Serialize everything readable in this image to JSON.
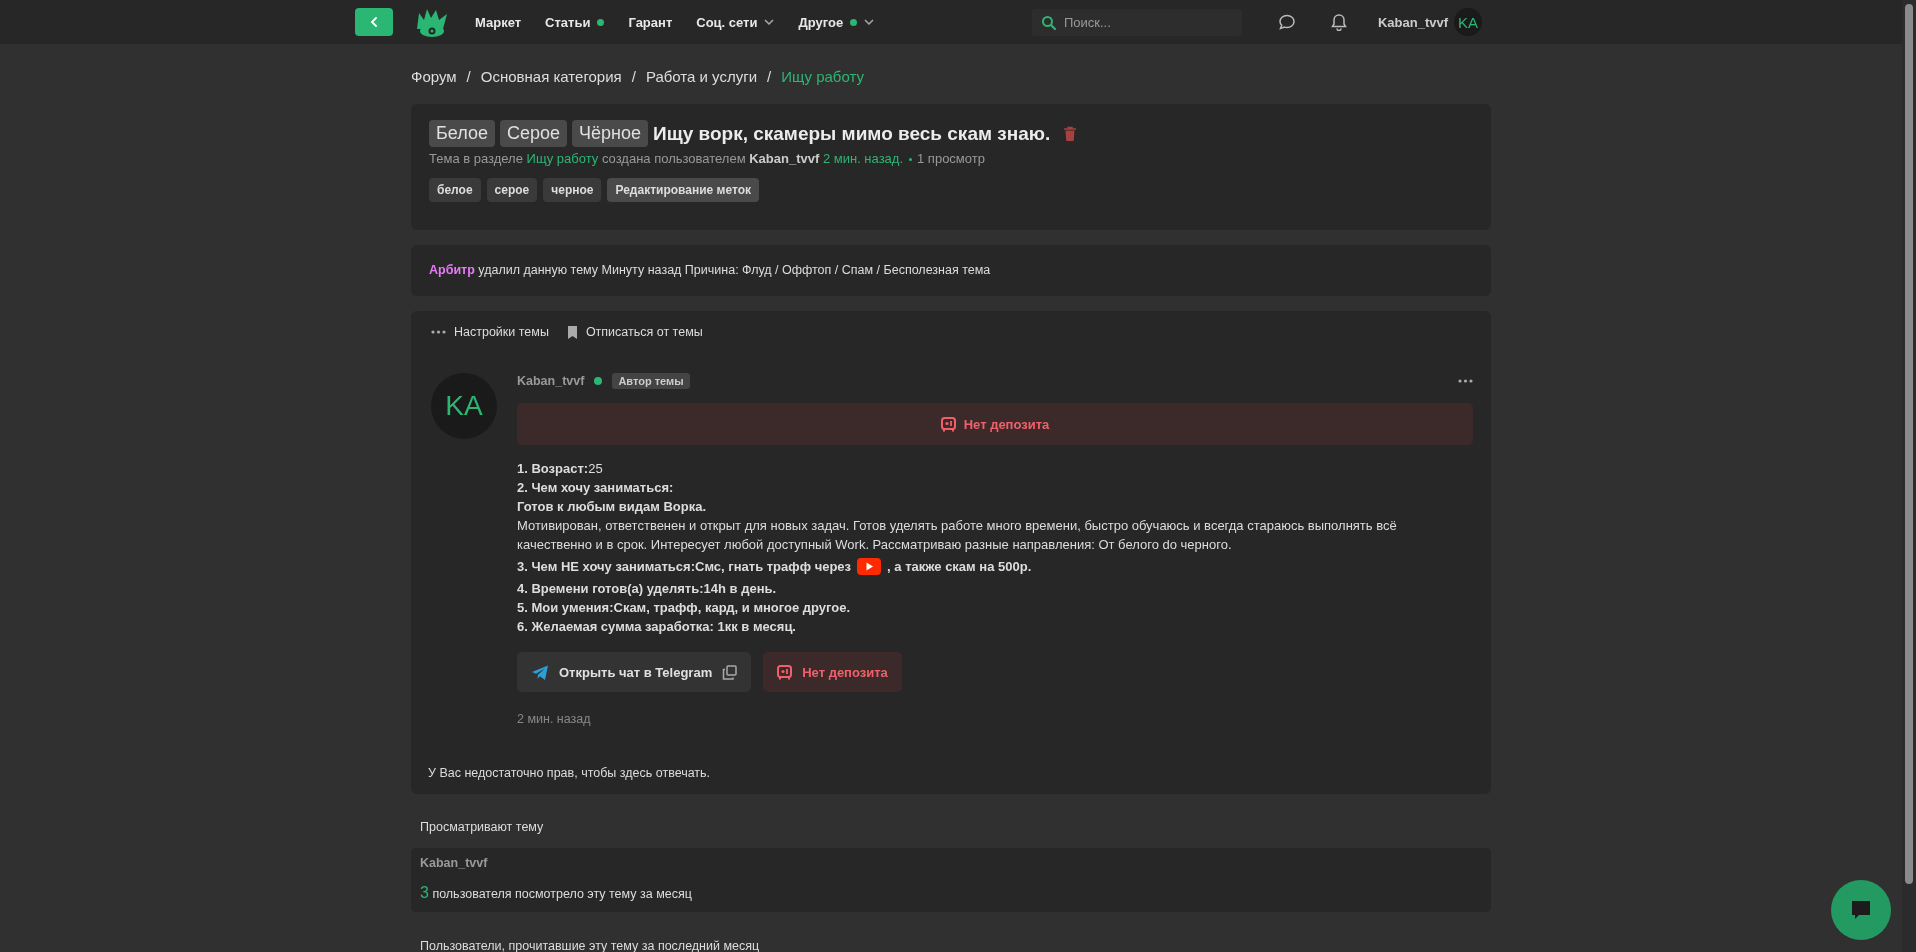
{
  "header": {
    "nav": [
      {
        "label": "Маркет",
        "dot": false,
        "dropdown": false
      },
      {
        "label": "Статьи",
        "dot": true,
        "dropdown": false
      },
      {
        "label": "Гарант",
        "dot": false,
        "dropdown": false
      },
      {
        "label": "Соц. сети",
        "dot": false,
        "dropdown": true
      },
      {
        "label": "Другое",
        "dot": true,
        "dropdown": true
      }
    ],
    "search": {
      "placeholder": "Поиск..."
    },
    "username": "Kaban_tvvf",
    "avatar": "KA"
  },
  "breadcrumbs": [
    {
      "label": "Форум",
      "current": false
    },
    {
      "separator": "/",
      "label": "Основная категория",
      "current": false
    },
    {
      "separator": "/",
      "label": "Работа и услуги",
      "current": false
    },
    {
      "separator": "/",
      "label": "Ищу работу",
      "current": true
    }
  ],
  "thread": {
    "prefixes": [
      "Белое",
      "Серое",
      "Чёрное"
    ],
    "title": "Ищу ворк, скамеры мимо весь скам знаю.",
    "meta": {
      "prefix": "Тема в разделе",
      "section": "Ищу работу",
      "middle": "создана пользователем",
      "author": "Kaban_tvvf",
      "time": "2 мин. назад.",
      "views": "1 просмотр"
    },
    "tags": [
      "белое",
      "серое",
      "черное"
    ],
    "edit_tags": "Редактирование меток"
  },
  "deletion_notice": {
    "moderator": "Арбитр",
    "text": "удалил данную тему Минуту назад Причина: Флуд / Оффтоп / Спам / Бесполезная тема"
  },
  "thread_actions": [
    "Настройки темы",
    "Отписаться от темы"
  ],
  "post": {
    "avatar": "KA",
    "username": "Kaban_tvvf",
    "online": true,
    "badge": "Автор темы",
    "deposit_banner": "Нет депозита",
    "lines": [
      {
        "kind": "text",
        "text": "**1. Возраст:**25"
      },
      {
        "kind": "bold",
        "text": "2. Чем хочу заниматься:"
      },
      {
        "kind": "bold",
        "text": "Готов к любым видам Ворка."
      },
      {
        "kind": "text",
        "text": "Мотивирован, ответственен и открыт для новых задач. Готов уделять работе много времени, быстро обучаюсь и всегда стараюсь выполнять всё качественно и в срок. Интересует любой доступный Work. Рассматриваю разные направления: От белого do черного."
      },
      {
        "kind": "video",
        "before": "3. Чем НЕ хочу заниматься:Смс, гнать трафф через",
        "after": ", а также скам на 500р."
      },
      {
        "kind": "bold",
        "text": "4. Времени готов(а) уделять:14h в день."
      },
      {
        "kind": "bold",
        "text": "5. Мои умения:Скам, трафф, кард, и многое другое."
      },
      {
        "kind": "bold",
        "text": "6. Желаемая сумма заработка: 1кк в месяц."
      }
    ],
    "telegram_button": "Открыть чат в Telegram",
    "deposit_button": "Нет депозита",
    "time": "2 мин. назад",
    "reply_notice": "У Вас недостаточно прав, чтобы здесь отвечать."
  },
  "viewers": {
    "heading": "Просматривают тему",
    "users": [
      "Kaban_tvvf"
    ],
    "count": "3",
    "count_text": "пользователя посмотрело эту тему за месяц"
  },
  "readers": {
    "heading": "Пользователи, прочитавшие эту тему за последний месяц"
  }
}
